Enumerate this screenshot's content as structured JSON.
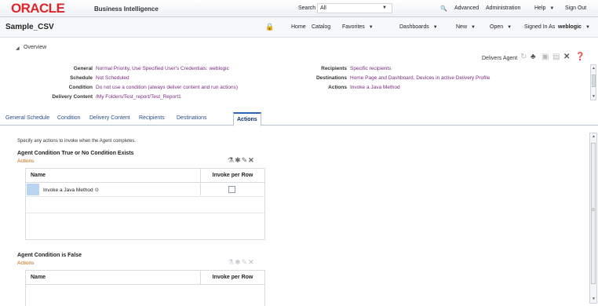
{
  "header": {
    "logo": "ORACLE",
    "logo_sub": "Business Intelligence",
    "search_label": "Search",
    "search_scope": "All",
    "advanced": "Advanced",
    "administration": "Administration",
    "help": "Help",
    "sign_out": "Sign Out"
  },
  "bar2": {
    "page_title": "Sample_CSV",
    "home": "Home",
    "catalog": "Catalog",
    "favorites": "Favorites",
    "dashboards": "Dashboards",
    "new": "New",
    "open": "Open",
    "signed_in_as": "Signed In As",
    "user": "weblogic"
  },
  "overview": {
    "title": "Overview",
    "left": [
      {
        "label": "General",
        "value": "Normal Priority, Use Specified User's Credentials: weblogic"
      },
      {
        "label": "Schedule",
        "value": "Not Scheduled"
      },
      {
        "label": "Condition",
        "value": "Do not use a condition (always deliver content and run actions)"
      },
      {
        "label": "Delivery Content",
        "value": "/My Folders/Test_report/Test_Report1"
      }
    ],
    "right": [
      {
        "label": "Recipients",
        "value": "Specific recipients"
      },
      {
        "label": "Destinations",
        "value": "Home Page and Dashboard, Devices in active Delivery Profile"
      },
      {
        "label": "Actions",
        "value": "Invoke a Java Method"
      }
    ],
    "delivers_agent": "Delivers Agent"
  },
  "tabs": [
    "General",
    "Schedule",
    "Condition",
    "Delivery Content",
    "Recipients",
    "Destinations",
    "Actions"
  ],
  "actions_panel": {
    "hint": "Specify any actions to invoke when the Agent completes.",
    "section1": {
      "title": "Agent Condition True or No Condition Exists",
      "sub": "Actions",
      "col_name": "Name",
      "col_invoke": "Invoke per Row",
      "rows": [
        {
          "name": "Invoke a Java Method",
          "invoke_per_row": false
        }
      ]
    },
    "section2": {
      "title": "Agent Condition is False",
      "sub": "Actions",
      "col_name": "Name",
      "col_invoke": "Invoke per Row"
    }
  }
}
